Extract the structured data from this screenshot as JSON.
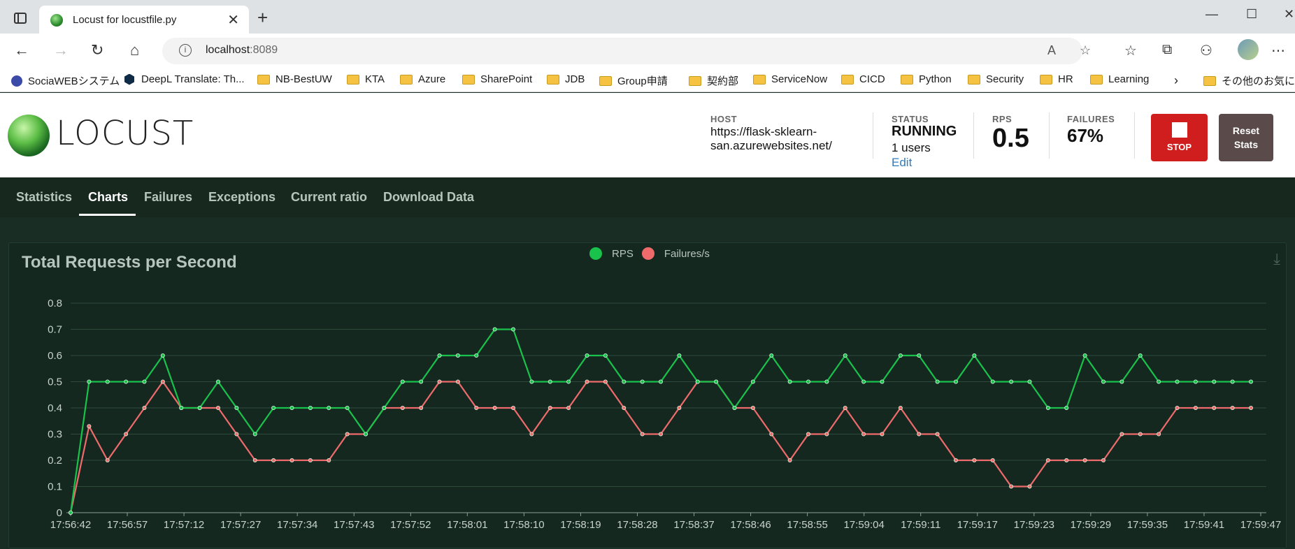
{
  "browser": {
    "tab_title": "Locust for locustfile.py",
    "url_host": "localhost",
    "url_port": ":8089",
    "bookmarks": [
      "SociaWEBシステム",
      "DeepL Translate: Th...",
      "NB-BestUW",
      "KTA",
      "Azure",
      "SharePoint",
      "JDB",
      "Group申請",
      "契約部",
      "ServiceNow",
      "CICD",
      "Python",
      "Security",
      "HR",
      "Learning",
      "その他のお気に入"
    ]
  },
  "header": {
    "logo": "LOCUST",
    "host_label": "HOST",
    "host_value": "https://flask-sklearn-san.azurewebsites.net/",
    "status_label": "STATUS",
    "status_value": "RUNNING",
    "users_value": "1 users",
    "edit_label": "Edit",
    "rps_label": "RPS",
    "rps_value": "0.5",
    "failures_label": "FAILURES",
    "failures_value": "67%",
    "stop_label": "STOP",
    "reset_label_1": "Reset",
    "reset_label_2": "Stats"
  },
  "nav": {
    "tabs": [
      "Statistics",
      "Charts",
      "Failures",
      "Exceptions",
      "Current ratio",
      "Download Data"
    ],
    "active": "Charts"
  },
  "colors": {
    "rps": "#19c24b",
    "failures": "#ef6b6b",
    "grid": "#2d4a3b"
  },
  "chart_data": {
    "type": "line",
    "title": "Total Requests per Second",
    "legend_placement": "top-center",
    "ylim": [
      0,
      0.8
    ],
    "yticks": [
      0,
      0.1,
      0.2,
      0.3,
      0.4,
      0.5,
      0.6,
      0.7,
      0.8
    ],
    "xtick_labels": [
      "17:56:42",
      "17:56:57",
      "17:57:12",
      "17:57:27",
      "17:57:34",
      "17:57:43",
      "17:57:52",
      "17:58:01",
      "17:58:10",
      "17:58:19",
      "17:58:28",
      "17:58:37",
      "17:58:46",
      "17:58:55",
      "17:59:04",
      "17:59:11",
      "17:59:17",
      "17:59:23",
      "17:59:29",
      "17:59:35",
      "17:59:41",
      "17:59:47"
    ],
    "series": [
      {
        "name": "RPS",
        "values": [
          0,
          0.5,
          0.5,
          0.5,
          0.5,
          0.6,
          0.4,
          0.4,
          0.5,
          0.4,
          0.3,
          0.4,
          0.4,
          0.4,
          0.4,
          0.4,
          0.3,
          0.4,
          0.5,
          0.5,
          0.6,
          0.6,
          0.6,
          0.7,
          0.7,
          0.5,
          0.5,
          0.5,
          0.6,
          0.6,
          0.5,
          0.5,
          0.5,
          0.6,
          0.5,
          0.5,
          0.4,
          0.5,
          0.6,
          0.5,
          0.5,
          0.5,
          0.6,
          0.5,
          0.5,
          0.6,
          0.6,
          0.5,
          0.5,
          0.6,
          0.5,
          0.5,
          0.5,
          0.4,
          0.4,
          0.6,
          0.5,
          0.5,
          0.6,
          0.5,
          0.5,
          0.5,
          0.5,
          0.5,
          0.5
        ]
      },
      {
        "name": "Failures/s",
        "values": [
          0,
          0.33,
          0.2,
          0.3,
          0.4,
          0.5,
          0.4,
          0.4,
          0.4,
          0.3,
          0.2,
          0.2,
          0.2,
          0.2,
          0.2,
          0.3,
          0.3,
          0.4,
          0.4,
          0.4,
          0.5,
          0.5,
          0.4,
          0.4,
          0.4,
          0.3,
          0.4,
          0.4,
          0.5,
          0.5,
          0.4,
          0.3,
          0.3,
          0.4,
          0.5,
          0.5,
          0.4,
          0.4,
          0.3,
          0.2,
          0.3,
          0.3,
          0.4,
          0.3,
          0.3,
          0.4,
          0.3,
          0.3,
          0.2,
          0.2,
          0.2,
          0.1,
          0.1,
          0.2,
          0.2,
          0.2,
          0.2,
          0.3,
          0.3,
          0.3,
          0.4,
          0.4,
          0.4,
          0.4,
          0.4
        ]
      }
    ]
  }
}
